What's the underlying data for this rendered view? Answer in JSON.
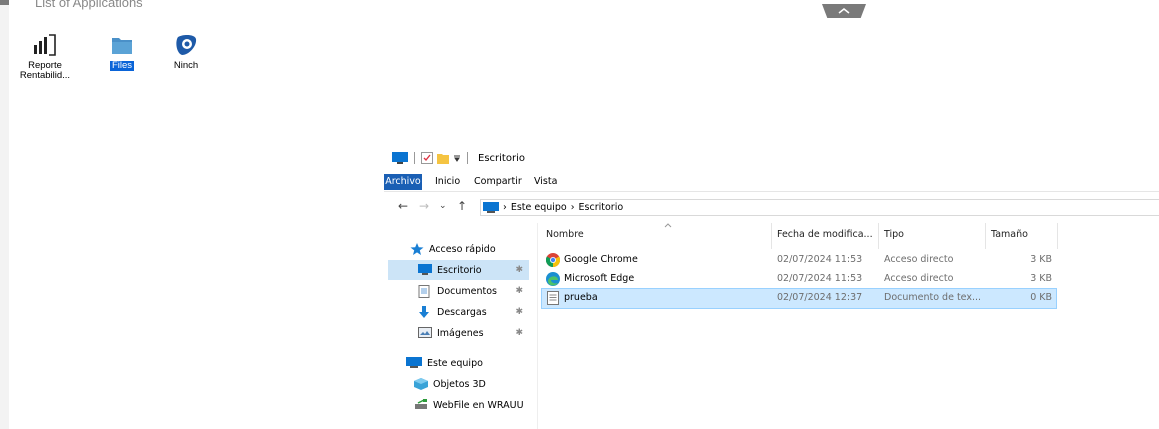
{
  "launcher": {
    "title": "List of Applications",
    "apps": [
      {
        "label_line1": "Reporte",
        "label_line2": "Rentabilid...",
        "icon": "power-bi-icon",
        "selected": false
      },
      {
        "label_line1": "Files",
        "label_line2": "",
        "icon": "folder-icon",
        "selected": true
      },
      {
        "label_line1": "Ninch",
        "label_line2": "",
        "icon": "ninch-icon",
        "selected": false
      }
    ]
  },
  "explorer": {
    "window_title": "Escritorio",
    "ribbon_tabs": [
      "Archivo",
      "Inicio",
      "Compartir",
      "Vista"
    ],
    "breadcrumb": [
      "Este equipo",
      "Escritorio"
    ],
    "nav": {
      "quick_access": "Acceso rápido",
      "items": [
        {
          "label": "Escritorio",
          "icon": "desktop-icon",
          "pinned": true,
          "selected": true
        },
        {
          "label": "Documentos",
          "icon": "documents-icon",
          "pinned": true,
          "selected": false
        },
        {
          "label": "Descargas",
          "icon": "downloads-icon",
          "pinned": true,
          "selected": false
        },
        {
          "label": "Imágenes",
          "icon": "pictures-icon",
          "pinned": true,
          "selected": false
        }
      ],
      "this_pc": "Este equipo",
      "objects3d": "Objetos 3D",
      "webfile": "WebFile en WRAUU"
    },
    "columns": [
      "Nombre",
      "Fecha de modifica...",
      "Tipo",
      "Tamaño"
    ],
    "files": [
      {
        "name": "Google Chrome",
        "date": "02/07/2024 11:53",
        "type": "Acceso directo",
        "size": "3 KB",
        "icon": "chrome-icon",
        "selected": false
      },
      {
        "name": "Microsoft Edge",
        "date": "02/07/2024 11:53",
        "type": "Acceso directo",
        "size": "3 KB",
        "icon": "edge-icon",
        "selected": false
      },
      {
        "name": "prueba",
        "date": "02/07/2024 12:37",
        "type": "Documento de tex...",
        "size": "0 KB",
        "icon": "text-file-icon",
        "selected": true
      }
    ],
    "pin_glyph": "📌"
  },
  "colors": {
    "accent": "#1a5fb4",
    "selection": "#cce8ff",
    "nav_selection": "#cce4f7"
  }
}
